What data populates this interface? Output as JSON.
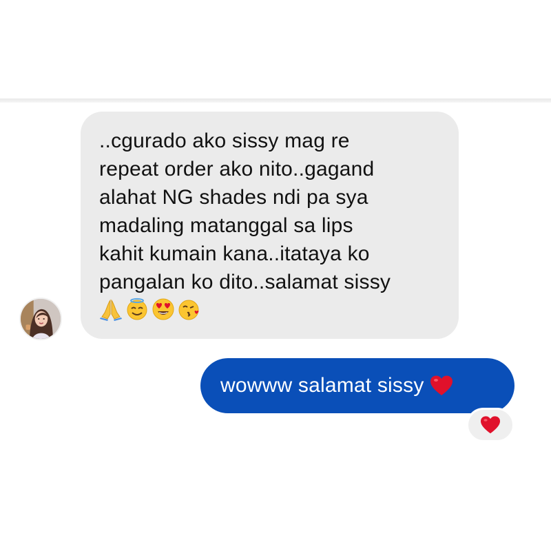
{
  "incoming_message": {
    "lines": [
      "..cgurado ako sissy mag re",
      "repeat order ako nito..gagand",
      "alahat NG shades ndi pa sya",
      "madaling matanggal sa lips",
      "kahit kumain kana..itataya ko",
      "pangalan ko dito..salamat sissy"
    ],
    "emojis": [
      "folded-hands-icon",
      "smiling-face-with-halo-icon",
      "heart-eyes-icon",
      "face-blowing-kiss-icon"
    ]
  },
  "outgoing_message": {
    "text": "wowww salamat sissy",
    "trailing_emoji": "red-heart-icon",
    "bubble_color": "#0a4fb8"
  },
  "reaction": {
    "emoji": "red-heart-icon"
  },
  "colors": {
    "incoming_bubble": "#ebebeb",
    "outgoing_bubble": "#0a4fb8",
    "heart": "#e0112b"
  }
}
